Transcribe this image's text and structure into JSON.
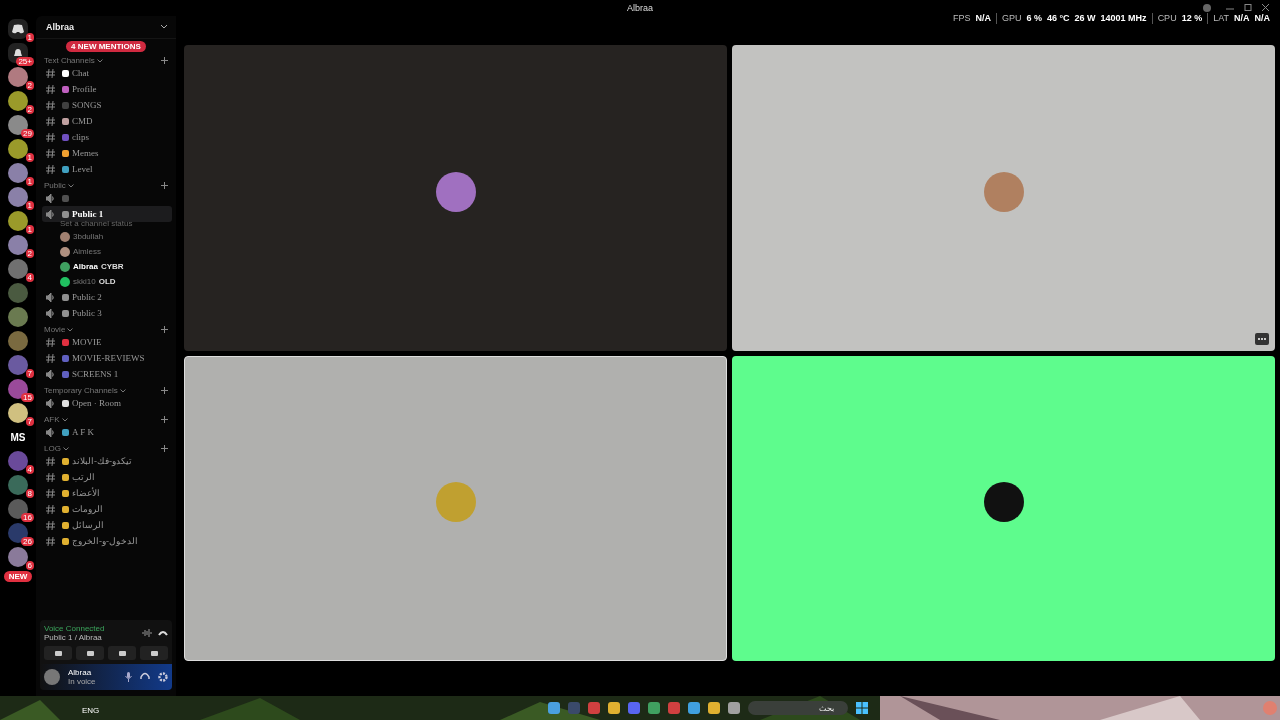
{
  "window": {
    "title": "Albraa"
  },
  "servers": [
    {
      "kind": "home",
      "badge": "1"
    },
    {
      "kind": "bell",
      "badge": "25+"
    },
    {
      "kind": "avatar",
      "badge": "2",
      "color": "#b07a80"
    },
    {
      "kind": "avatar",
      "badge": "2",
      "color": "#9a9a2a"
    },
    {
      "kind": "avatar",
      "badge": "29",
      "color": "#8a8a8a"
    },
    {
      "kind": "avatar",
      "badge": "1",
      "color": "#9a9a2a"
    },
    {
      "kind": "avatar",
      "badge": "1",
      "color": "#8a80a8"
    },
    {
      "kind": "avatar",
      "badge": "1",
      "color": "#8a80a8"
    },
    {
      "kind": "avatar",
      "badge": "1",
      "color": "#9a9a2a"
    },
    {
      "kind": "avatar",
      "badge": "2",
      "color": "#8a80a8"
    },
    {
      "kind": "avatar",
      "badge": "4",
      "color": "#707070"
    },
    {
      "kind": "avatar",
      "color": "#4a5a40"
    },
    {
      "kind": "avatar",
      "color": "#6a7a50"
    },
    {
      "kind": "avatar",
      "color": "#7a6a40"
    },
    {
      "kind": "avatar",
      "badge": "7",
      "color": "#6a5aa0"
    },
    {
      "kind": "avatar",
      "badge": "15",
      "color": "#9a4a9a"
    },
    {
      "kind": "avatar",
      "badge": "7",
      "color": "#d0c080"
    },
    {
      "kind": "text",
      "label": "MS"
    },
    {
      "kind": "avatar",
      "badge": "4",
      "color": "#6a4a9a"
    },
    {
      "kind": "avatar",
      "badge": "8",
      "color": "#3a6a5a"
    },
    {
      "kind": "avatar",
      "badge": "16",
      "color": "#5a5a5a"
    },
    {
      "kind": "avatar",
      "badge": "26",
      "color": "#2a3a6a"
    },
    {
      "kind": "avatar",
      "badge": "6",
      "color": "#8a7a9a"
    }
  ],
  "new_pill": "NEW",
  "server_name": "Albraa",
  "mentions": "4 NEW MENTIONS",
  "sections": [
    {
      "title": "Text Channels",
      "channels": [
        {
          "kind": "text",
          "name": "Chat",
          "selected": false,
          "color": "#ffffff"
        },
        {
          "kind": "text",
          "name": "Profile",
          "selected": false,
          "color": "#c060c0"
        },
        {
          "kind": "text",
          "name": "SONGS",
          "selected": false,
          "color": "#404040"
        },
        {
          "kind": "text",
          "name": "CMD",
          "selected": false,
          "color": "#c0a0a0"
        },
        {
          "kind": "text",
          "name": "clips",
          "selected": false,
          "color": "#7050c0"
        },
        {
          "kind": "text",
          "name": "Memes",
          "selected": false,
          "color": "#f0a030"
        },
        {
          "kind": "text",
          "name": "Level",
          "selected": false,
          "color": "#40a0c0"
        }
      ]
    },
    {
      "title": "Public",
      "channels": [
        {
          "kind": "voice",
          "selected": false,
          "color": "#505050"
        },
        {
          "kind": "voice",
          "name": "Public 1",
          "status": "Set a channel status",
          "selected": true,
          "color": "#909090",
          "users": [
            {
              "name": "3bdullah",
              "color": "#a08070"
            },
            {
              "name": "Aimless",
              "color": "#b09080"
            },
            {
              "name": "Albraa",
              "tag": "CYBR",
              "me": true,
              "color": "#40a060"
            },
            {
              "name": "skki10",
              "tag": "OLD",
              "color": "#20c060"
            }
          ]
        },
        {
          "kind": "voice",
          "name": "Public 2",
          "selected": false,
          "color": "#909090"
        },
        {
          "kind": "voice",
          "name": "Public 3",
          "selected": false,
          "color": "#909090"
        }
      ]
    },
    {
      "title": "Movie",
      "channels": [
        {
          "kind": "text",
          "name": "MOVIE",
          "selected": false,
          "color": "#e03040"
        },
        {
          "kind": "text",
          "name": "MOVIE-REVIEWS",
          "selected": false,
          "color": "#6060c0"
        },
        {
          "kind": "voice",
          "name": "SCREENS 1",
          "selected": false,
          "color": "#6060c0"
        }
      ]
    },
    {
      "title": "Temporary Channels",
      "channels": [
        {
          "kind": "voice",
          "name": "Open · Room",
          "selected": false,
          "color": "#e0e0e0"
        }
      ]
    },
    {
      "title": "AFK",
      "channels": [
        {
          "kind": "voice",
          "name": "A F K",
          "selected": false,
          "color": "#40a0c0"
        }
      ]
    },
    {
      "title": "LOG",
      "channels": [
        {
          "kind": "text",
          "name": "تيكدو-فك-البلاند",
          "selected": false,
          "color": "#e0b030"
        },
        {
          "kind": "text",
          "name": "الرتب",
          "selected": false,
          "color": "#e0b030"
        },
        {
          "kind": "text",
          "name": "الأعضاء",
          "selected": false,
          "color": "#e0b030"
        },
        {
          "kind": "text",
          "name": "الرومات",
          "selected": false,
          "color": "#e0b030"
        },
        {
          "kind": "text",
          "name": "الرسائل",
          "selected": false,
          "color": "#e0b030"
        },
        {
          "kind": "text",
          "name": "الدخول-و-الخروج",
          "selected": false,
          "color": "#e0b030"
        }
      ]
    }
  ],
  "voice_panel": {
    "status": "Voice Connected",
    "channel": "Public 1 / Albraa"
  },
  "user_panel": {
    "name": "Albraa",
    "status": "In voice"
  },
  "stats": [
    {
      "label": "FPS",
      "values": [
        "N/A"
      ]
    },
    {
      "label": "GPU",
      "values": [
        "6 %",
        "46 °C",
        "26 W",
        "14001 MHz"
      ]
    },
    {
      "label": "CPU",
      "values": [
        "12 %"
      ]
    },
    {
      "label": "LAT",
      "values": [
        "N/A",
        "N/A"
      ]
    }
  ],
  "tiles": [
    {
      "color": "#262321",
      "selected": false,
      "more": false
    },
    {
      "color": "#c2c2c0",
      "selected": false,
      "more": true
    },
    {
      "color": "#b0b0ae",
      "selected": true,
      "more": false
    },
    {
      "color": "#5efc8d",
      "selected": false,
      "more": false
    }
  ],
  "taskbar": {
    "language": "ENG",
    "search": "بحث"
  }
}
